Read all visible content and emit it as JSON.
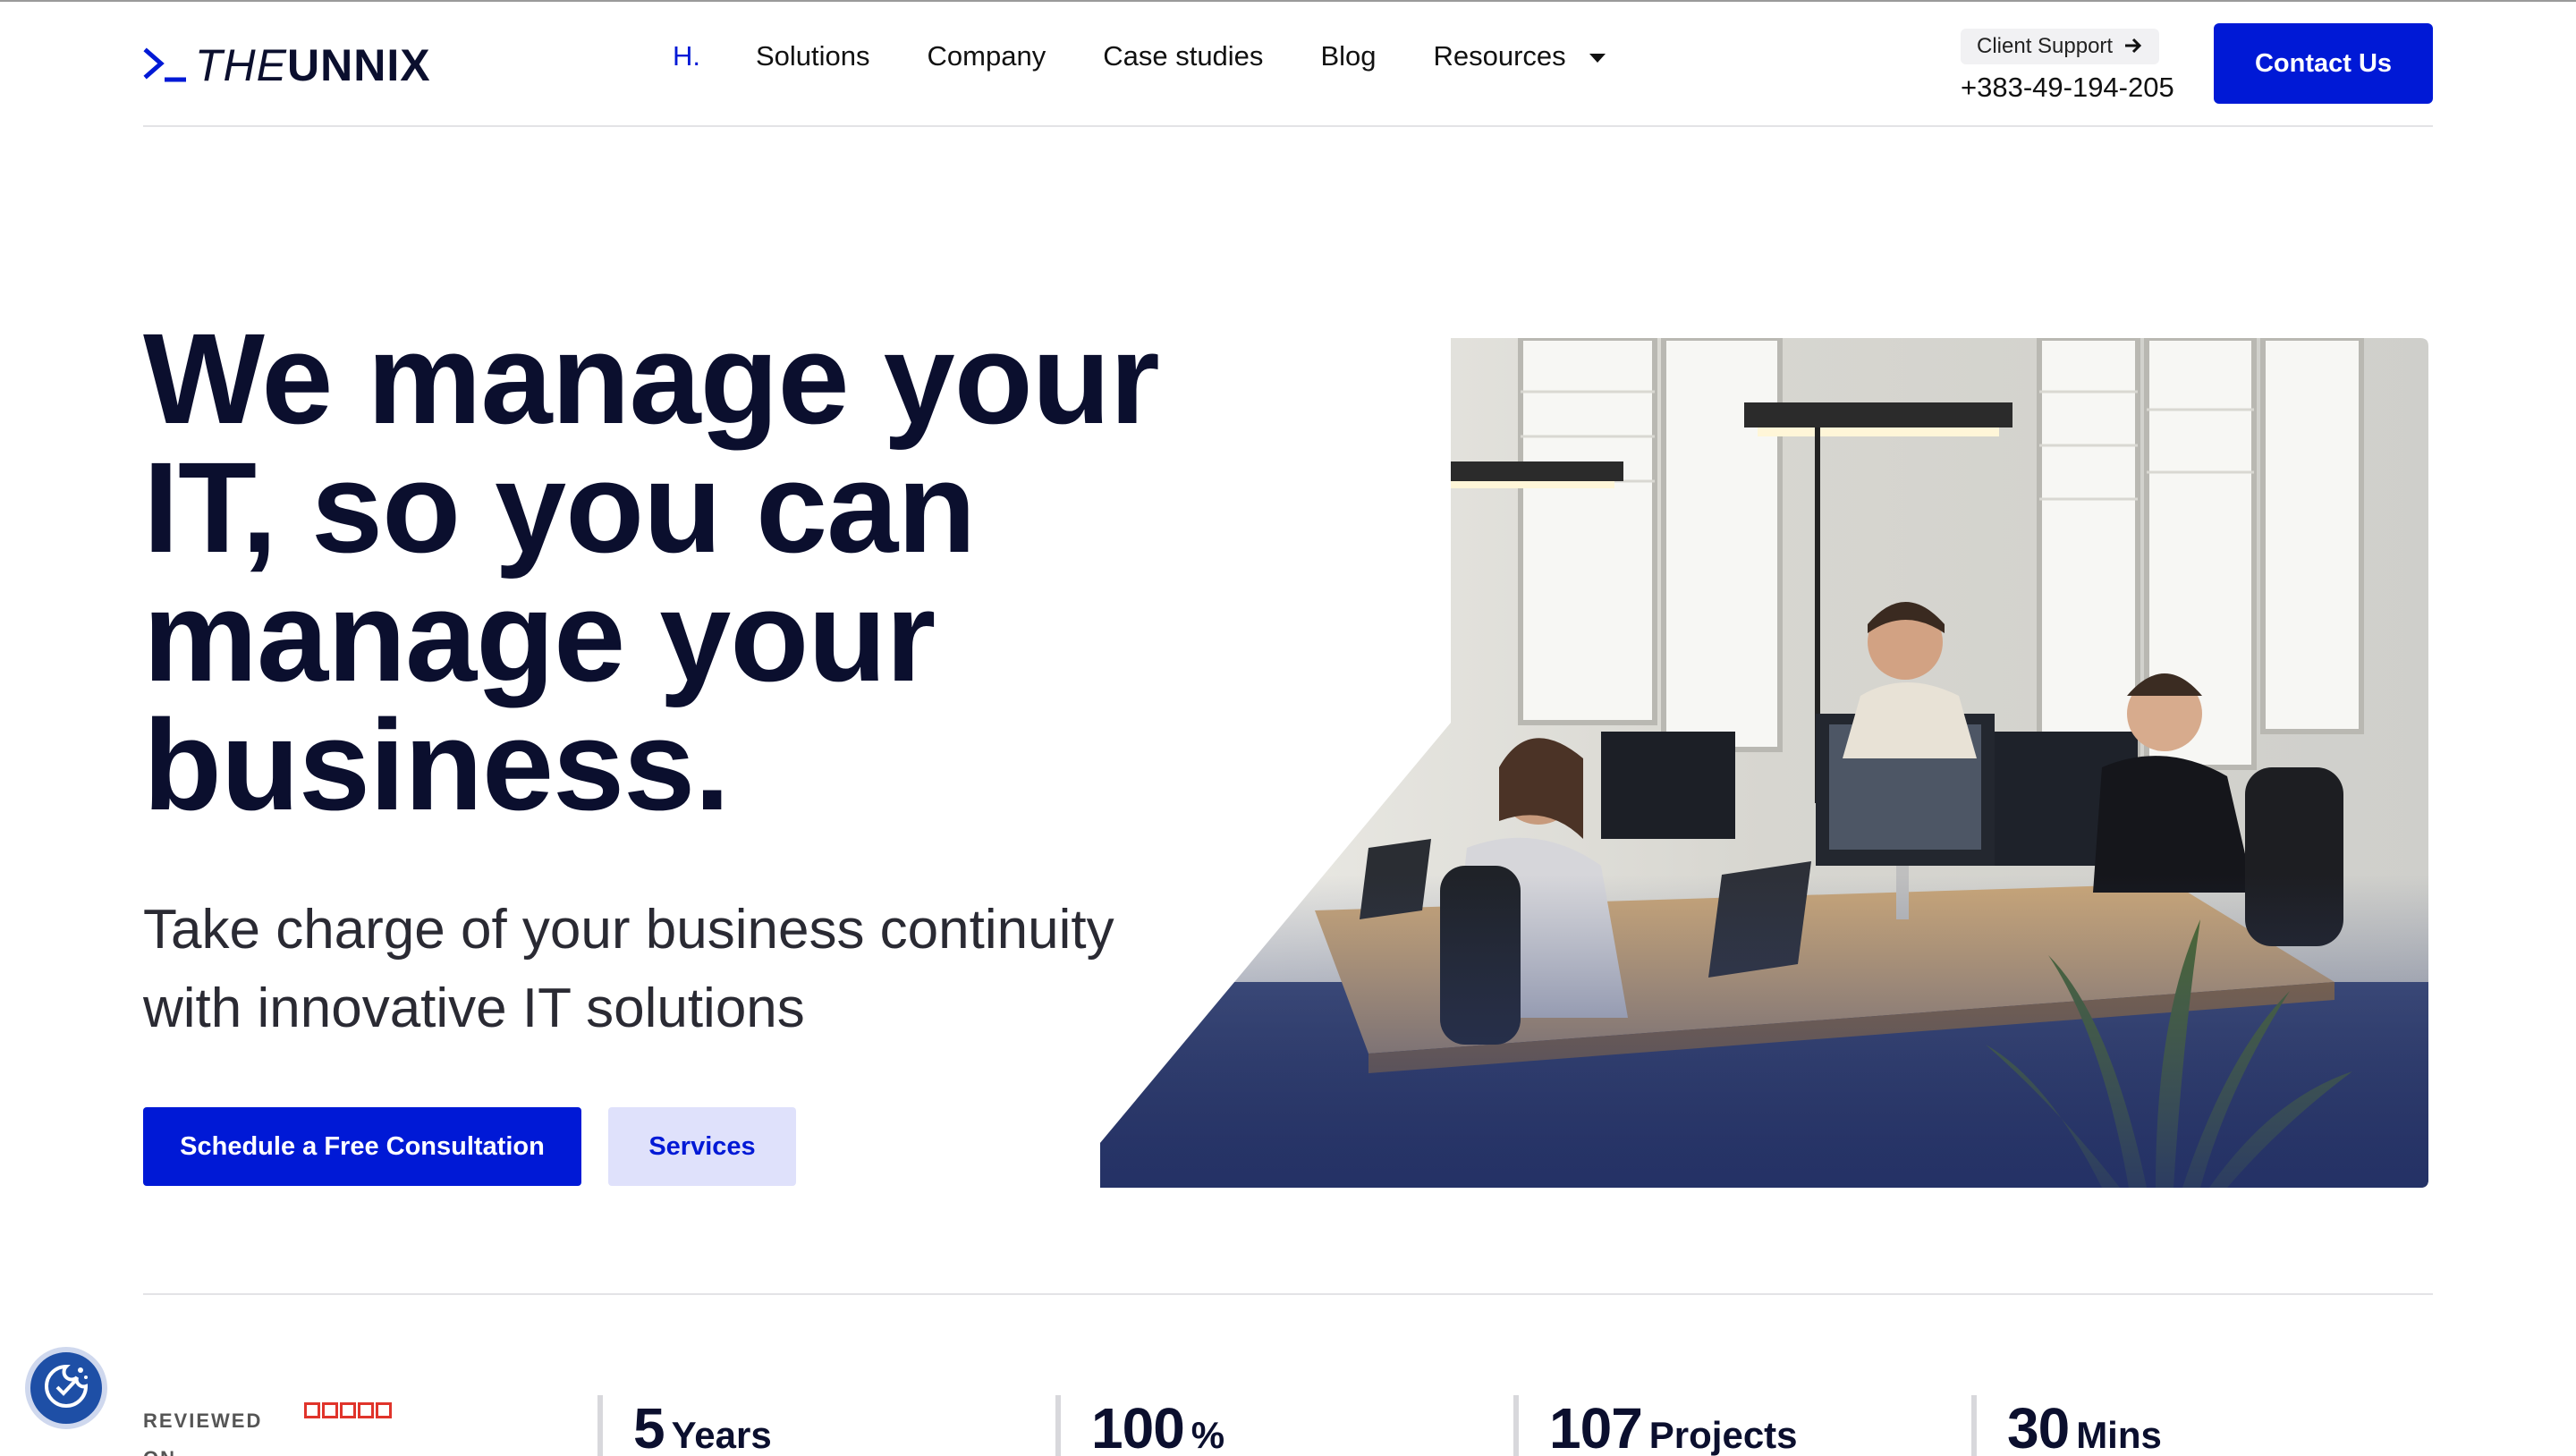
{
  "header": {
    "logo": {
      "prefix": "THE",
      "brand": "UNNIX"
    },
    "nav": [
      {
        "label": "H.",
        "active": true
      },
      {
        "label": "Solutions"
      },
      {
        "label": "Company"
      },
      {
        "label": "Case studies"
      },
      {
        "label": "Blog"
      },
      {
        "label": "Resources",
        "has_dropdown": true
      }
    ],
    "support": {
      "label": "Client Support",
      "phone": "+383-49-194-205"
    },
    "contact_label": "Contact Us"
  },
  "hero": {
    "title_lines": [
      "We manage your",
      "IT, so you can",
      "manage your",
      "business."
    ],
    "subtitle_lines": [
      "Take charge of your business continuity",
      "with innovative IT solutions"
    ],
    "primary_button": "Schedule a Free Consultation",
    "secondary_button": "Services"
  },
  "stats": {
    "reviewed_label": "REVIEWED ON",
    "items": [
      {
        "value": "5",
        "unit": "Years"
      },
      {
        "value": "100",
        "unit": "%"
      },
      {
        "value": "107",
        "unit": "Projects"
      },
      {
        "value": "30",
        "unit": "Mins"
      }
    ]
  },
  "colors": {
    "accent": "#0019d6",
    "accent_light": "#dfe1fb",
    "heading": "#0b0f2e",
    "review_stars": "#e0342b"
  },
  "icons": {
    "logo": "terminal-prompt-icon",
    "support_arrow": "arrow-right-icon",
    "dropdown": "caret-down-icon",
    "cookie": "cookie-consent-icon"
  }
}
